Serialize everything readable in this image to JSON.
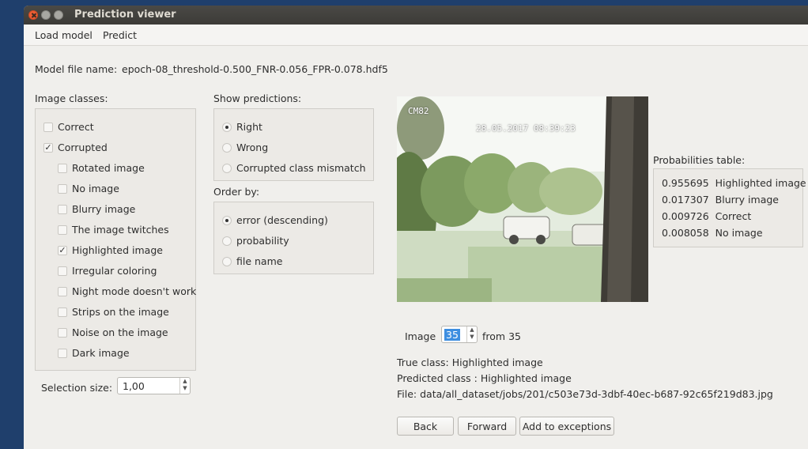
{
  "window": {
    "title": "Prediction viewer"
  },
  "menu": {
    "items": [
      "Load model",
      "Predict"
    ]
  },
  "model": {
    "label": "Model file name:",
    "value": "epoch-08_threshold-0.500_FNR-0.056_FPR-0.078.hdf5"
  },
  "image_classes": {
    "title": "Image classes:",
    "items": [
      {
        "label": "Correct",
        "checked": false
      },
      {
        "label": "Corrupted",
        "checked": true
      },
      {
        "label": "Rotated image",
        "checked": false
      },
      {
        "label": "No image",
        "checked": false
      },
      {
        "label": "Blurry image",
        "checked": false
      },
      {
        "label": "The image twitches",
        "checked": false
      },
      {
        "label": "Highlighted image",
        "checked": true
      },
      {
        "label": "Irregular coloring",
        "checked": false
      },
      {
        "label": "Night mode doesn't work",
        "checked": false
      },
      {
        "label": "Strips on the image",
        "checked": false
      },
      {
        "label": "Noise on the image",
        "checked": false
      },
      {
        "label": "Dark image",
        "checked": false
      }
    ]
  },
  "selection": {
    "label": "Selection size:",
    "value": "1,00"
  },
  "show_predictions": {
    "title": "Show predictions:",
    "options": [
      "Right",
      "Wrong",
      "Corrupted class mismatch"
    ],
    "selected": 0
  },
  "order_by": {
    "title": "Order by:",
    "options": [
      "error (descending)",
      "probability",
      "file name"
    ],
    "selected": 0
  },
  "preview": {
    "overlay_id": "CM82",
    "overlay_timestamp": "28.05.2017 08:39:23"
  },
  "probabilities": {
    "title": "Probabilities table:",
    "rows": [
      {
        "value": "0.955695",
        "label": "Highlighted image"
      },
      {
        "value": "0.017307",
        "label": "Blurry image"
      },
      {
        "value": "0.009726",
        "label": "Correct"
      },
      {
        "value": "0.008058",
        "label": "No image"
      }
    ]
  },
  "navigator": {
    "label": "Image",
    "current": "35",
    "from_label": "from 35"
  },
  "info": {
    "true_class": "True class: Highlighted image",
    "predicted_class": "Predicted class : Highlighted image",
    "file": "File: data/all_dataset/jobs/201/c503e73d-3dbf-40ec-b687-92c65f219d83.jpg"
  },
  "buttons": {
    "back": "Back",
    "forward": "Forward",
    "add_exceptions": "Add to exceptions"
  },
  "colors": {
    "desktop": "#1f3f6c",
    "window_bg": "#f0efec",
    "close_button": "#ef5d33",
    "selection_highlight": "#3d8ee0"
  }
}
